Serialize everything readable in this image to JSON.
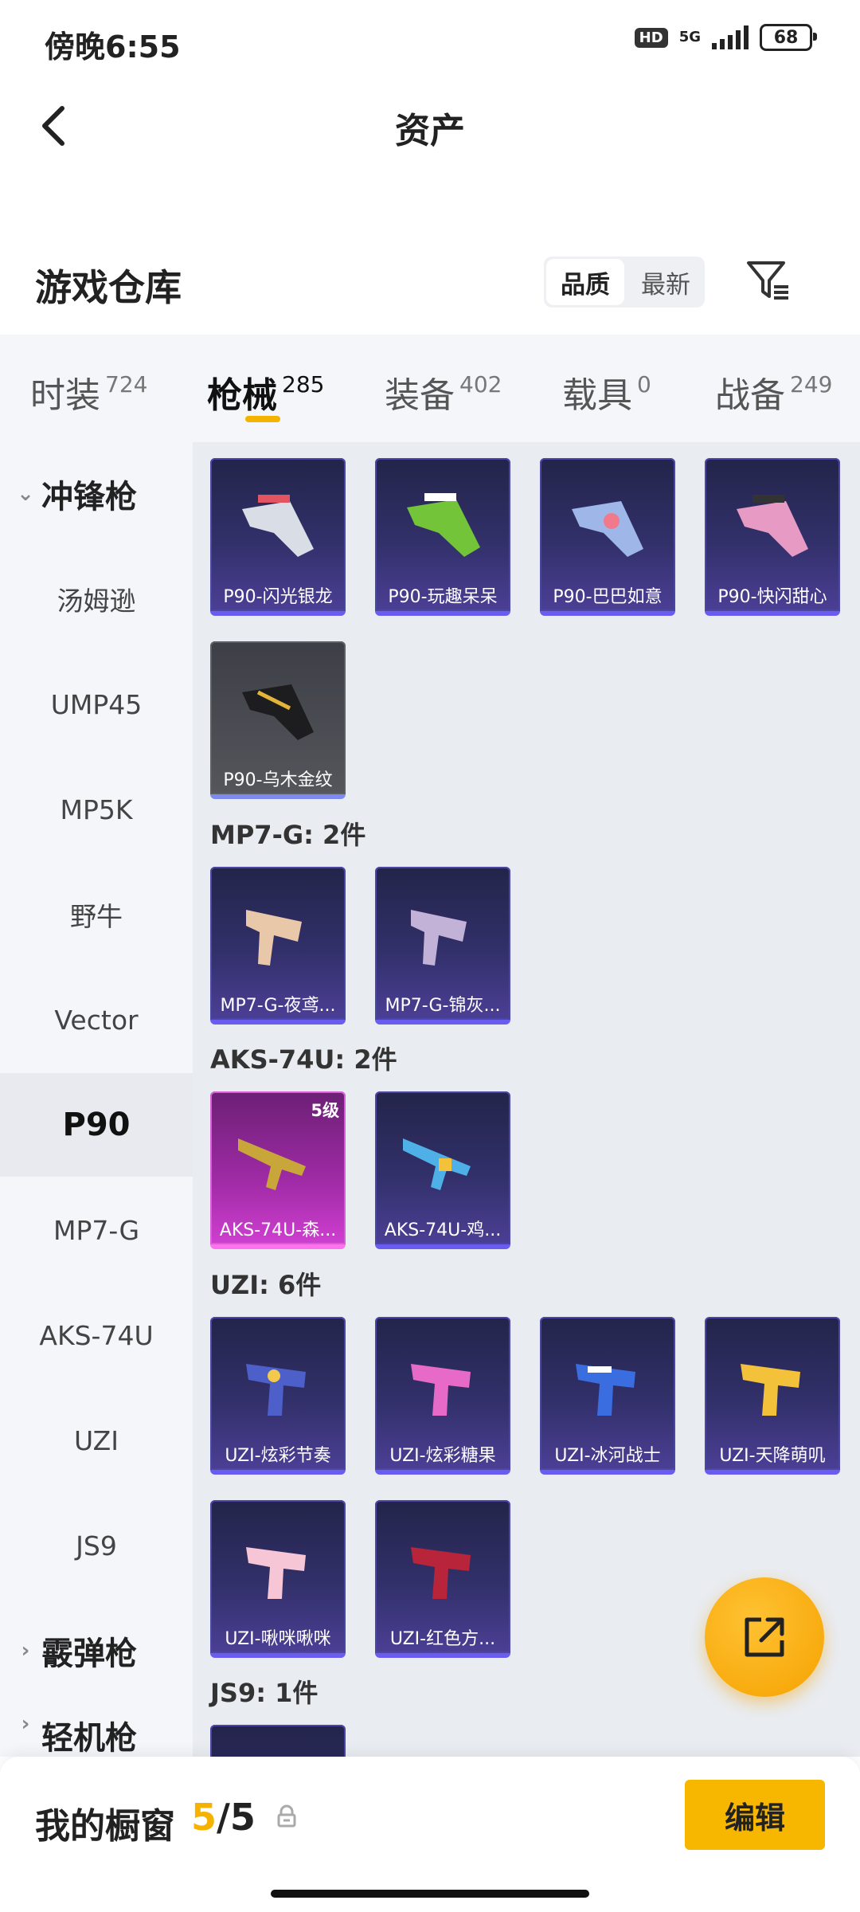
{
  "status": {
    "time": "傍晚6:55",
    "hd": "HD",
    "network": "5G",
    "battery": "68"
  },
  "nav": {
    "title": "资产"
  },
  "header": {
    "title": "游戏仓库",
    "sort_options": [
      "品质",
      "最新"
    ],
    "sort_active": "品质"
  },
  "tabs": [
    {
      "label": "时装",
      "count": "724"
    },
    {
      "label": "枪械",
      "count": "285",
      "active": true
    },
    {
      "label": "装备",
      "count": "402"
    },
    {
      "label": "载具",
      "count": "0"
    },
    {
      "label": "战备",
      "count": "249"
    }
  ],
  "sidebar": {
    "category_open": "冲锋枪",
    "items": [
      "汤姆逊",
      "UMP45",
      "MP5K",
      "野牛",
      "Vector",
      "P90",
      "MP7-G",
      "AKS-74U",
      "UZI",
      "JS9"
    ],
    "active": "P90",
    "category_next": "霰弹枪",
    "category_partial": "轻机枪"
  },
  "groups": {
    "p90": {
      "items": [
        "P90-闪光银龙",
        "P90-玩趣呆呆",
        "P90-巴巴如意",
        "P90-快闪甜心",
        "P90-乌木金纹"
      ]
    },
    "mp7": {
      "title": "MP7-G: 2件",
      "items": [
        "MP7-G-夜鸢...",
        "MP7-G-锦灰..."
      ]
    },
    "aks": {
      "title": "AKS-74U: 2件",
      "items": [
        "AKS-74U-森...",
        "AKS-74U-鸡..."
      ],
      "level_badge": "5级"
    },
    "uzi": {
      "title": "UZI: 6件",
      "items": [
        "UZI-炫彩节奏",
        "UZI-炫彩糖果",
        "UZI-冰河战士",
        "UZI-天降萌叽",
        "UZI-啾咪啾咪",
        "UZI-红色方..."
      ]
    },
    "js9": {
      "title": "JS9: 1件"
    }
  },
  "bottom": {
    "showcase_label": "我的橱窗",
    "showcase_current": "5",
    "showcase_sep_total": "/5",
    "edit_label": "编辑"
  },
  "colors": {
    "accent": "#f5b300",
    "card_purple": "#32306a",
    "card_pink": "#a12ba7",
    "card_gray": "#54565c"
  },
  "icons": {
    "back": "chevron-left-icon",
    "filter": "filter-icon",
    "share": "share-out-icon",
    "lock": "lock-icon"
  }
}
